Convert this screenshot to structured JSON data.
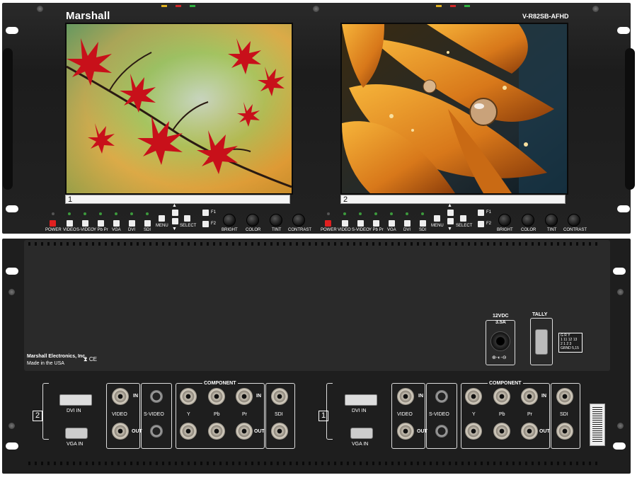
{
  "front_panel": {
    "brand": "Marshall",
    "model": "V-R82SB-AFHD",
    "status_led_colors": [
      "#e0b020",
      "#d02828",
      "#30b040"
    ],
    "monitors": [
      {
        "channel": "1",
        "image_icon": "red-maple-leaves-photo",
        "buttons": [
          "POWER",
          "VIDEO",
          "S-VIDEO",
          "Y Pb Pr",
          "VGA",
          "DVI",
          "SDI",
          "MENU",
          "SELECT",
          "F1",
          "F2"
        ],
        "knobs": [
          "BRIGHT",
          "COLOR",
          "TINT",
          "CONTRAST"
        ]
      },
      {
        "channel": "2",
        "image_icon": "orange-flower-dewdrops-photo",
        "buttons": [
          "POWER",
          "VIDEO",
          "S-VIDEO",
          "Y Pb Pr",
          "VGA",
          "DVI",
          "SDI",
          "MENU",
          "SELECT",
          "F1",
          "F2"
        ],
        "knobs": [
          "BRIGHT",
          "COLOR",
          "TINT",
          "CONTRAST"
        ]
      }
    ]
  },
  "rear_panel": {
    "manufacturer": "Marshall Electronics, Inc.",
    "origin": "Made in the USA",
    "cert_marks": "⧗ CE",
    "power_rating_volts": "12VDC",
    "power_rating_amps": "3.5A",
    "tally_label": "TALLY",
    "tally_table": {
      "header": [
        "G",
        "R",
        "Y"
      ],
      "row1": [
        "1",
        "11",
        "12",
        "13"
      ],
      "row2": [
        "2",
        "1",
        "2",
        "3"
      ],
      "footer": [
        "GRND",
        "5,15"
      ]
    },
    "inputs": [
      {
        "channel": "2",
        "dvi": "DVI IN",
        "vga": "VGA IN",
        "video": "VIDEO",
        "svideo": "S-VIDEO",
        "component_title": "COMPONENT",
        "y": "Y",
        "pb": "Pb",
        "pr": "Pr",
        "sdi": "SDI",
        "in": "IN",
        "out": "OUT"
      },
      {
        "channel": "1",
        "dvi": "DVI IN",
        "vga": "VGA IN",
        "video": "VIDEO",
        "svideo": "S-VIDEO",
        "component_title": "COMPONENT",
        "y": "Y",
        "pb": "Pb",
        "pr": "Pr",
        "sdi": "SDI",
        "in": "IN",
        "out": "OUT"
      }
    ]
  }
}
